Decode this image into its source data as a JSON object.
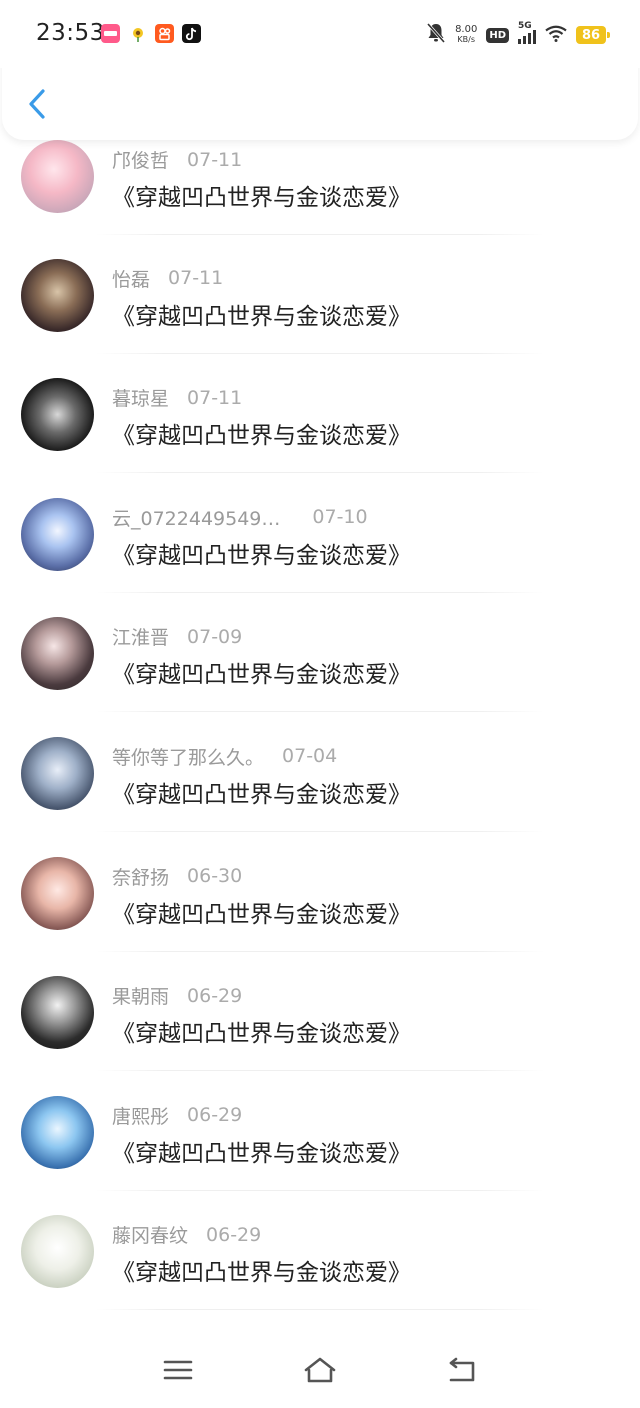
{
  "status_bar": {
    "time": "23:53",
    "app_icons": [
      "lofter-icon",
      "flower-icon",
      "kuaishou-icon",
      "tiktok-icon"
    ],
    "net_speed_value": "8.00",
    "net_speed_unit": "KB/s",
    "hd_label": "HD",
    "network_label": "5G",
    "battery_level": "86"
  },
  "header": {
    "back_icon": "chevron-left-icon",
    "accent_color": "#3a9be8"
  },
  "list": {
    "items": [
      {
        "name": "邝俊哲",
        "date": "07-11",
        "title": "《穿越凹凸世界与金谈恋爱》"
      },
      {
        "name": "怡磊",
        "date": "07-11",
        "title": "《穿越凹凸世界与金谈恋爱》"
      },
      {
        "name": "暮琼星",
        "date": "07-11",
        "title": "《穿越凹凸世界与金谈恋爱》"
      },
      {
        "name": "云_0722449549…",
        "date": "07-10",
        "title": "《穿越凹凸世界与金谈恋爱》"
      },
      {
        "name": "江淮晋",
        "date": "07-09",
        "title": "《穿越凹凸世界与金谈恋爱》"
      },
      {
        "name": "等你等了那么久。",
        "date": "07-04",
        "title": "《穿越凹凸世界与金谈恋爱》"
      },
      {
        "name": "奈舒扬",
        "date": "06-30",
        "title": "《穿越凹凸世界与金谈恋爱》"
      },
      {
        "name": "果朝雨",
        "date": "06-29",
        "title": "《穿越凹凸世界与金谈恋爱》"
      },
      {
        "name": "唐熙彤",
        "date": "06-29",
        "title": "《穿越凹凸世界与金谈恋爱》"
      },
      {
        "name": "藤冈春纹",
        "date": "06-29",
        "title": "《穿越凹凸世界与金谈恋爱》"
      }
    ]
  },
  "navbar": {
    "icons": [
      "menu-icon",
      "home-icon",
      "back-return-icon"
    ]
  }
}
